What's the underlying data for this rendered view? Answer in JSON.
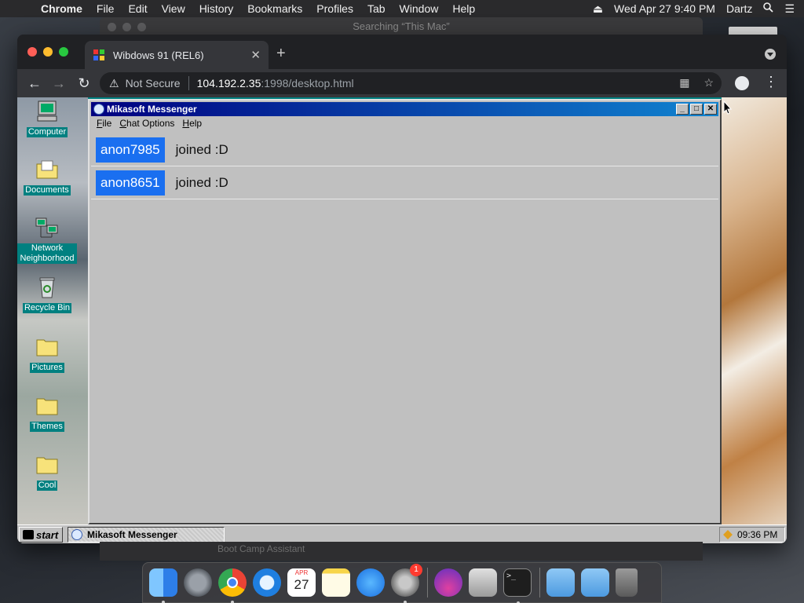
{
  "mac_menubar": {
    "app_name": "Chrome",
    "menus": [
      "File",
      "Edit",
      "View",
      "History",
      "Bookmarks",
      "Profiles",
      "Tab",
      "Window",
      "Help"
    ],
    "datetime": "Wed Apr 27  9:40 PM",
    "user": "Dartz"
  },
  "ghost_windows": {
    "finder_title": "Searching “This Mac”",
    "bootcamp_label": "Boot Camp Assistant"
  },
  "browser": {
    "tab_title": "Wibdows 91 (REL6)",
    "security_label": "Not Secure",
    "url_host": "104.192.2.35",
    "url_path": ":1998/desktop.html"
  },
  "desktop": {
    "icons": [
      {
        "label": "Computer",
        "icon": "computer-icon"
      },
      {
        "label": "Documents",
        "icon": "folder-documents-icon"
      },
      {
        "label": "Network Neighborhood",
        "icon": "network-icon"
      },
      {
        "label": "Recycle Bin",
        "icon": "recycle-bin-icon"
      },
      {
        "label": "Pictures",
        "icon": "folder-icon"
      },
      {
        "label": "Themes",
        "icon": "folder-icon"
      },
      {
        "label": "Cool",
        "icon": "folder-icon"
      }
    ]
  },
  "messenger": {
    "title": "Mikasoft Messenger",
    "menu": [
      "File",
      "Chat Options",
      "Help"
    ],
    "messages": [
      {
        "user": "anon7985",
        "text": "joined :D"
      },
      {
        "user": "anon8651",
        "text": "joined :D"
      }
    ],
    "user_badge_color": "#1a6ff0"
  },
  "taskbar": {
    "start_label": "start",
    "task_label": "Mikasoft Messenger",
    "clock": "09:36 PM"
  },
  "dock": {
    "items": [
      "finder-icon",
      "launchpad-icon",
      "chrome-icon",
      "safari-icon",
      "calendar-icon",
      "notes-icon",
      "app-store-icon",
      "system-preferences-icon",
      "installer-icon",
      "boot-camp-icon",
      "terminal-icon",
      "applications-folder-icon",
      "downloads-folder-icon",
      "trash-icon"
    ],
    "calendar_month": "APR",
    "calendar_day": "27",
    "system_preferences_badge": "1"
  }
}
